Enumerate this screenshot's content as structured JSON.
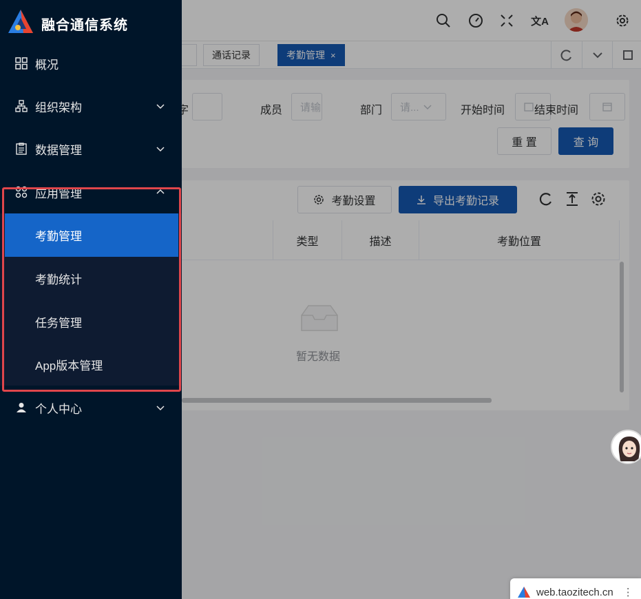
{
  "sidebar": {
    "title": "融合通信系统",
    "items": [
      {
        "label": "概况",
        "icon": "grid-icon"
      },
      {
        "label": "组织架构",
        "icon": "org-icon"
      },
      {
        "label": "数据管理",
        "icon": "clipboard-icon"
      },
      {
        "label": "应用管理",
        "icon": "apps-icon",
        "expanded": true,
        "children": [
          {
            "label": "考勤管理",
            "active": true
          },
          {
            "label": "考勤统计"
          },
          {
            "label": "任务管理"
          },
          {
            "label": "App版本管理"
          }
        ]
      },
      {
        "label": "个人中心",
        "icon": "user-icon"
      }
    ]
  },
  "tabs": [
    {
      "label": "通话记录"
    },
    {
      "label": "考勤管理",
      "active": true,
      "close": "×"
    }
  ],
  "filters": {
    "label_partial": "字",
    "member_label": "成员",
    "member_placeholder": "请输",
    "dept_label": "部门",
    "dept_placeholder": "请...",
    "start_label": "开始时间",
    "end_label": "结束时间",
    "reset": "重 置",
    "search": "查 询"
  },
  "toolbar": {
    "settings": "考勤设置",
    "export": "导出考勤记录"
  },
  "table": {
    "columns": [
      "类型",
      "描述",
      "考勤位置"
    ],
    "empty_text": "暂无数据"
  },
  "watermark": "web.taozitech.cn",
  "colors": {
    "sidebar_bg": "#001529",
    "primary": "#1659b3",
    "active_menu": "#1565c8",
    "highlight_border": "#e0464b"
  }
}
